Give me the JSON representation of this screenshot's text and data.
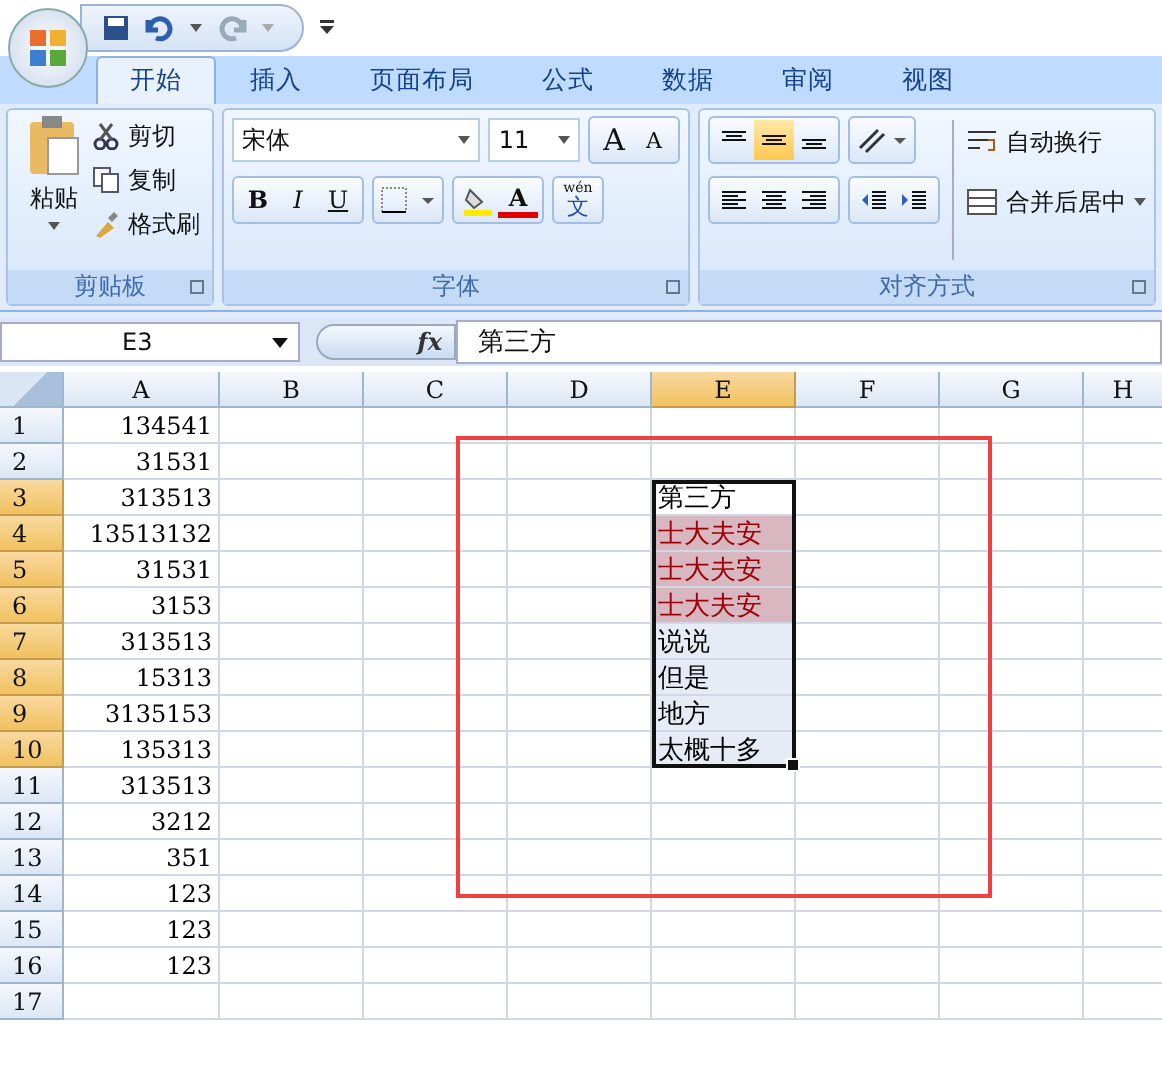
{
  "tabs": [
    {
      "label": "开始",
      "selected": true
    },
    {
      "label": "插入",
      "selected": false
    },
    {
      "label": "页面布局",
      "selected": false
    },
    {
      "label": "公式",
      "selected": false
    },
    {
      "label": "数据",
      "selected": false
    },
    {
      "label": "审阅",
      "selected": false
    },
    {
      "label": "视图",
      "selected": false
    }
  ],
  "clipboard": {
    "paste": "粘贴",
    "cut": "剪切",
    "copy": "复制",
    "format_painter": "格式刷",
    "title": "剪贴板"
  },
  "font": {
    "name": "宋体",
    "size": "11",
    "grow": "A",
    "shrink": "A",
    "bold": "B",
    "italic": "I",
    "underline": "U",
    "color_letter": "A",
    "phonetic_top": "wén",
    "phonetic_char": "文",
    "title": "字体"
  },
  "alignment": {
    "vertical": [
      {
        "selected": false
      },
      {
        "selected": true
      },
      {
        "selected": false
      }
    ],
    "wrap_text": "自动换行",
    "merge_center": "合并后居中",
    "title": "对齐方式"
  },
  "name_box": "E3",
  "function_label": "fx",
  "formula": "第三方",
  "columns": [
    {
      "label": "A",
      "selected": false
    },
    {
      "label": "B",
      "selected": false
    },
    {
      "label": "C",
      "selected": false
    },
    {
      "label": "D",
      "selected": false
    },
    {
      "label": "E",
      "selected": true
    },
    {
      "label": "F",
      "selected": false
    },
    {
      "label": "G",
      "selected": false
    },
    {
      "label": "H",
      "selected": false
    }
  ],
  "rows": [
    {
      "number": "1",
      "selected": false,
      "a": "134541"
    },
    {
      "number": "2",
      "selected": false,
      "a": "31531"
    },
    {
      "number": "3",
      "selected": true,
      "a": "313513",
      "e": "第三方",
      "active": true
    },
    {
      "number": "4",
      "selected": true,
      "a": "13513132",
      "e": "士大夫安",
      "highlighted": true
    },
    {
      "number": "5",
      "selected": true,
      "a": "31531",
      "e": "士大夫安",
      "highlighted": true
    },
    {
      "number": "6",
      "selected": true,
      "a": "3153",
      "e": "士大夫安",
      "highlighted": true
    },
    {
      "number": "7",
      "selected": true,
      "a": "313513",
      "e": "说说"
    },
    {
      "number": "8",
      "selected": true,
      "a": "15313",
      "e": "但是"
    },
    {
      "number": "9",
      "selected": true,
      "a": "3135153",
      "e": "地方"
    },
    {
      "number": "10",
      "selected": true,
      "a": "135313",
      "e": "太概十多"
    },
    {
      "number": "11",
      "selected": false,
      "a": "313513"
    },
    {
      "number": "12",
      "selected": false,
      "a": "3212"
    },
    {
      "number": "13",
      "selected": false,
      "a": "351"
    },
    {
      "number": "14",
      "selected": false,
      "a": "123"
    },
    {
      "number": "15",
      "selected": false,
      "a": "123"
    },
    {
      "number": "16",
      "selected": false,
      "a": "123"
    },
    {
      "number": "17",
      "selected": false
    }
  ]
}
